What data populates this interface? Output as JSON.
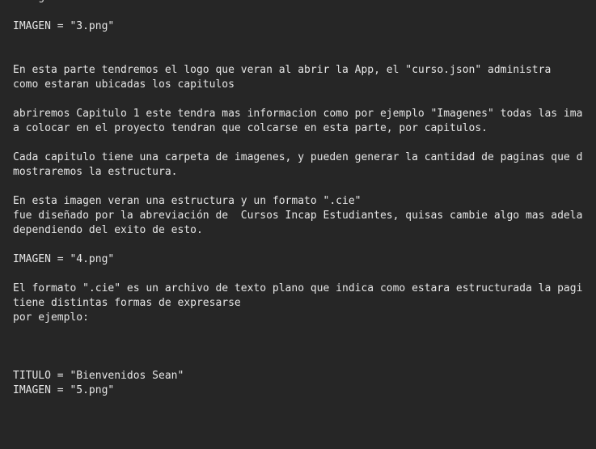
{
  "document": {
    "lines": [
      "   ng",
      "",
      "IMAGEN = \"3.png\"",
      "",
      "",
      "En esta parte tendremos el logo que veran al abrir la App, el \"curso.json\" administra",
      "como estaran ubicadas los capitulos",
      "",
      "abriremos Capitulo 1 este tendra mas informacion como por ejemplo \"Imagenes\" todas las ima",
      "a colocar en el proyecto tendran que colcarse en esta parte, por capitulos.",
      "",
      "Cada capitulo tiene una carpeta de imagenes, y pueden generar la cantidad de paginas que d",
      "mostraremos la estructura.",
      "",
      "En esta imagen veran una estructura y un formato \".cie\"",
      "fue diseñado por la abreviación de  Cursos Incap Estudiantes, quisas cambie algo mas adela",
      "dependiendo del exito de esto.",
      "",
      "IMAGEN = \"4.png\"",
      "",
      "El formato \".cie\" es un archivo de texto plano que indica como estara estructurada la pagi",
      "tiene distintas formas de expresarse",
      "por ejemplo:",
      "",
      "",
      "",
      "TITULO = \"Bienvenidos Sean\"",
      "IMAGEN = \"5.png\"",
      "",
      "",
      ""
    ]
  }
}
